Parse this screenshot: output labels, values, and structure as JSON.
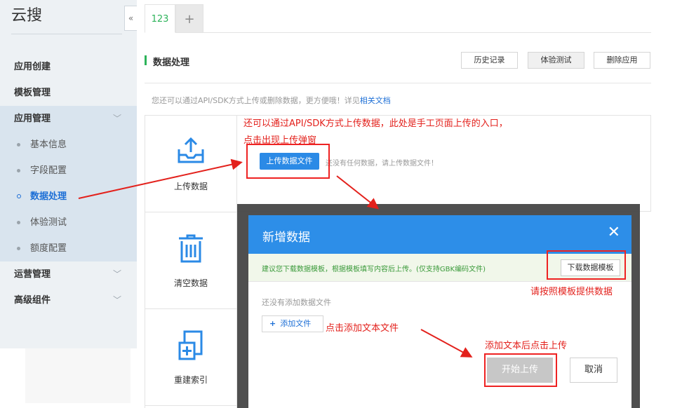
{
  "sidebar": {
    "logo": "云搜",
    "collapse_icon": "«",
    "menu": [
      {
        "label": "应用创建"
      },
      {
        "label": "模板管理"
      }
    ],
    "app_manage": {
      "label": "应用管理",
      "chevron": "﹀",
      "sub": [
        {
          "label": "基本信息"
        },
        {
          "label": "字段配置"
        },
        {
          "label": "数据处理"
        },
        {
          "label": "体验测试"
        },
        {
          "label": "额度配置"
        }
      ]
    },
    "ops": {
      "label": "运营管理",
      "chevron": "﹀"
    },
    "advanced": {
      "label": "高级组件",
      "chevron": "﹀"
    }
  },
  "tabs": {
    "active": "123",
    "add": "+"
  },
  "header": {
    "title": "数据处理",
    "history": "历史记录",
    "test": "体验测试",
    "delete": "删除应用",
    "tip_prefix": "您还可以通过API/SDK方式上传或删除数据，更方便哦！详见",
    "tip_link": "相关文档"
  },
  "cards": [
    {
      "label": "上传数据",
      "icon": "upload-tray-icon"
    },
    {
      "label": "清空数据",
      "icon": "trash-icon"
    },
    {
      "label": "重建索引",
      "icon": "add-document-icon"
    }
  ],
  "upload": {
    "button": "上传数据文件",
    "hint": "还没有任何数据，请上传数据文件！"
  },
  "modal": {
    "title": "新增数据",
    "close": "✕",
    "notice": "建议您下载数据模板，根据模板填写内容后上传。(仅支持GBK编码文件)",
    "download": "下载数据模板",
    "empty": "还没有添加数据文件",
    "add_plus": "+",
    "add_file": "添加文件",
    "start": "开始上传",
    "cancel": "取消"
  },
  "annotations": {
    "a1_line1": "还可以通过API/SDK方式上传数据，此处是手工页面上传的入口，",
    "a1_line2": "点击出现上传弹窗",
    "a2": "请按照模板提供数据",
    "a3": "点击添加文本文件",
    "a4": "添加文本后点击上传"
  },
  "colors": {
    "accent_blue": "#2d8ee8",
    "accent_green": "#2db35a",
    "annotation_red": "#e3211c"
  }
}
